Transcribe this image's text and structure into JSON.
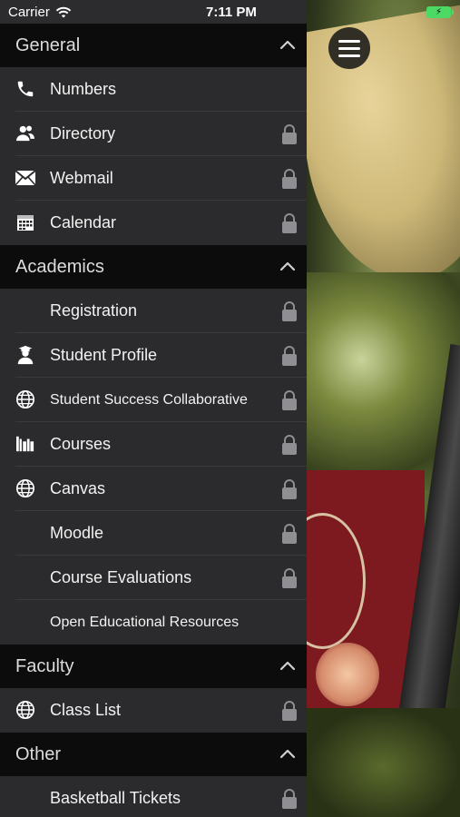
{
  "status_bar": {
    "carrier": "Carrier",
    "time": "7:11 PM",
    "battery_color": "#4cd964"
  },
  "menu_button": {
    "icon": "hamburger-icon"
  },
  "sections": [
    {
      "title": "General",
      "items": [
        {
          "label": "Numbers",
          "icon": "phone-icon",
          "locked": false
        },
        {
          "label": "Directory",
          "icon": "people-icon",
          "locked": true
        },
        {
          "label": "Webmail",
          "icon": "mail-icon",
          "locked": true
        },
        {
          "label": "Calendar",
          "icon": "calendar-icon",
          "locked": true
        }
      ]
    },
    {
      "title": "Academics",
      "items": [
        {
          "label": "Registration",
          "icon": "",
          "locked": true
        },
        {
          "label": "Student Profile",
          "icon": "graduate-icon",
          "locked": true
        },
        {
          "label": "Student Success Collaborative",
          "icon": "globe-icon",
          "locked": true
        },
        {
          "label": "Courses",
          "icon": "books-icon",
          "locked": true
        },
        {
          "label": "Canvas",
          "icon": "globe-icon",
          "locked": true
        },
        {
          "label": "Moodle",
          "icon": "",
          "locked": true
        },
        {
          "label": "Course Evaluations",
          "icon": "",
          "locked": true
        },
        {
          "label": "Open Educational Resources",
          "icon": "",
          "locked": false
        }
      ]
    },
    {
      "title": "Faculty",
      "items": [
        {
          "label": "Class List",
          "icon": "globe-icon",
          "locked": true
        }
      ]
    },
    {
      "title": "Other",
      "items": [
        {
          "label": "Basketball Tickets",
          "icon": "",
          "locked": true
        }
      ]
    }
  ],
  "colors": {
    "sidebar_bg": "#2b2b2d",
    "header_bg": "#0c0c0c",
    "text": "#f2f2f2",
    "lock": "#8e8e93"
  }
}
